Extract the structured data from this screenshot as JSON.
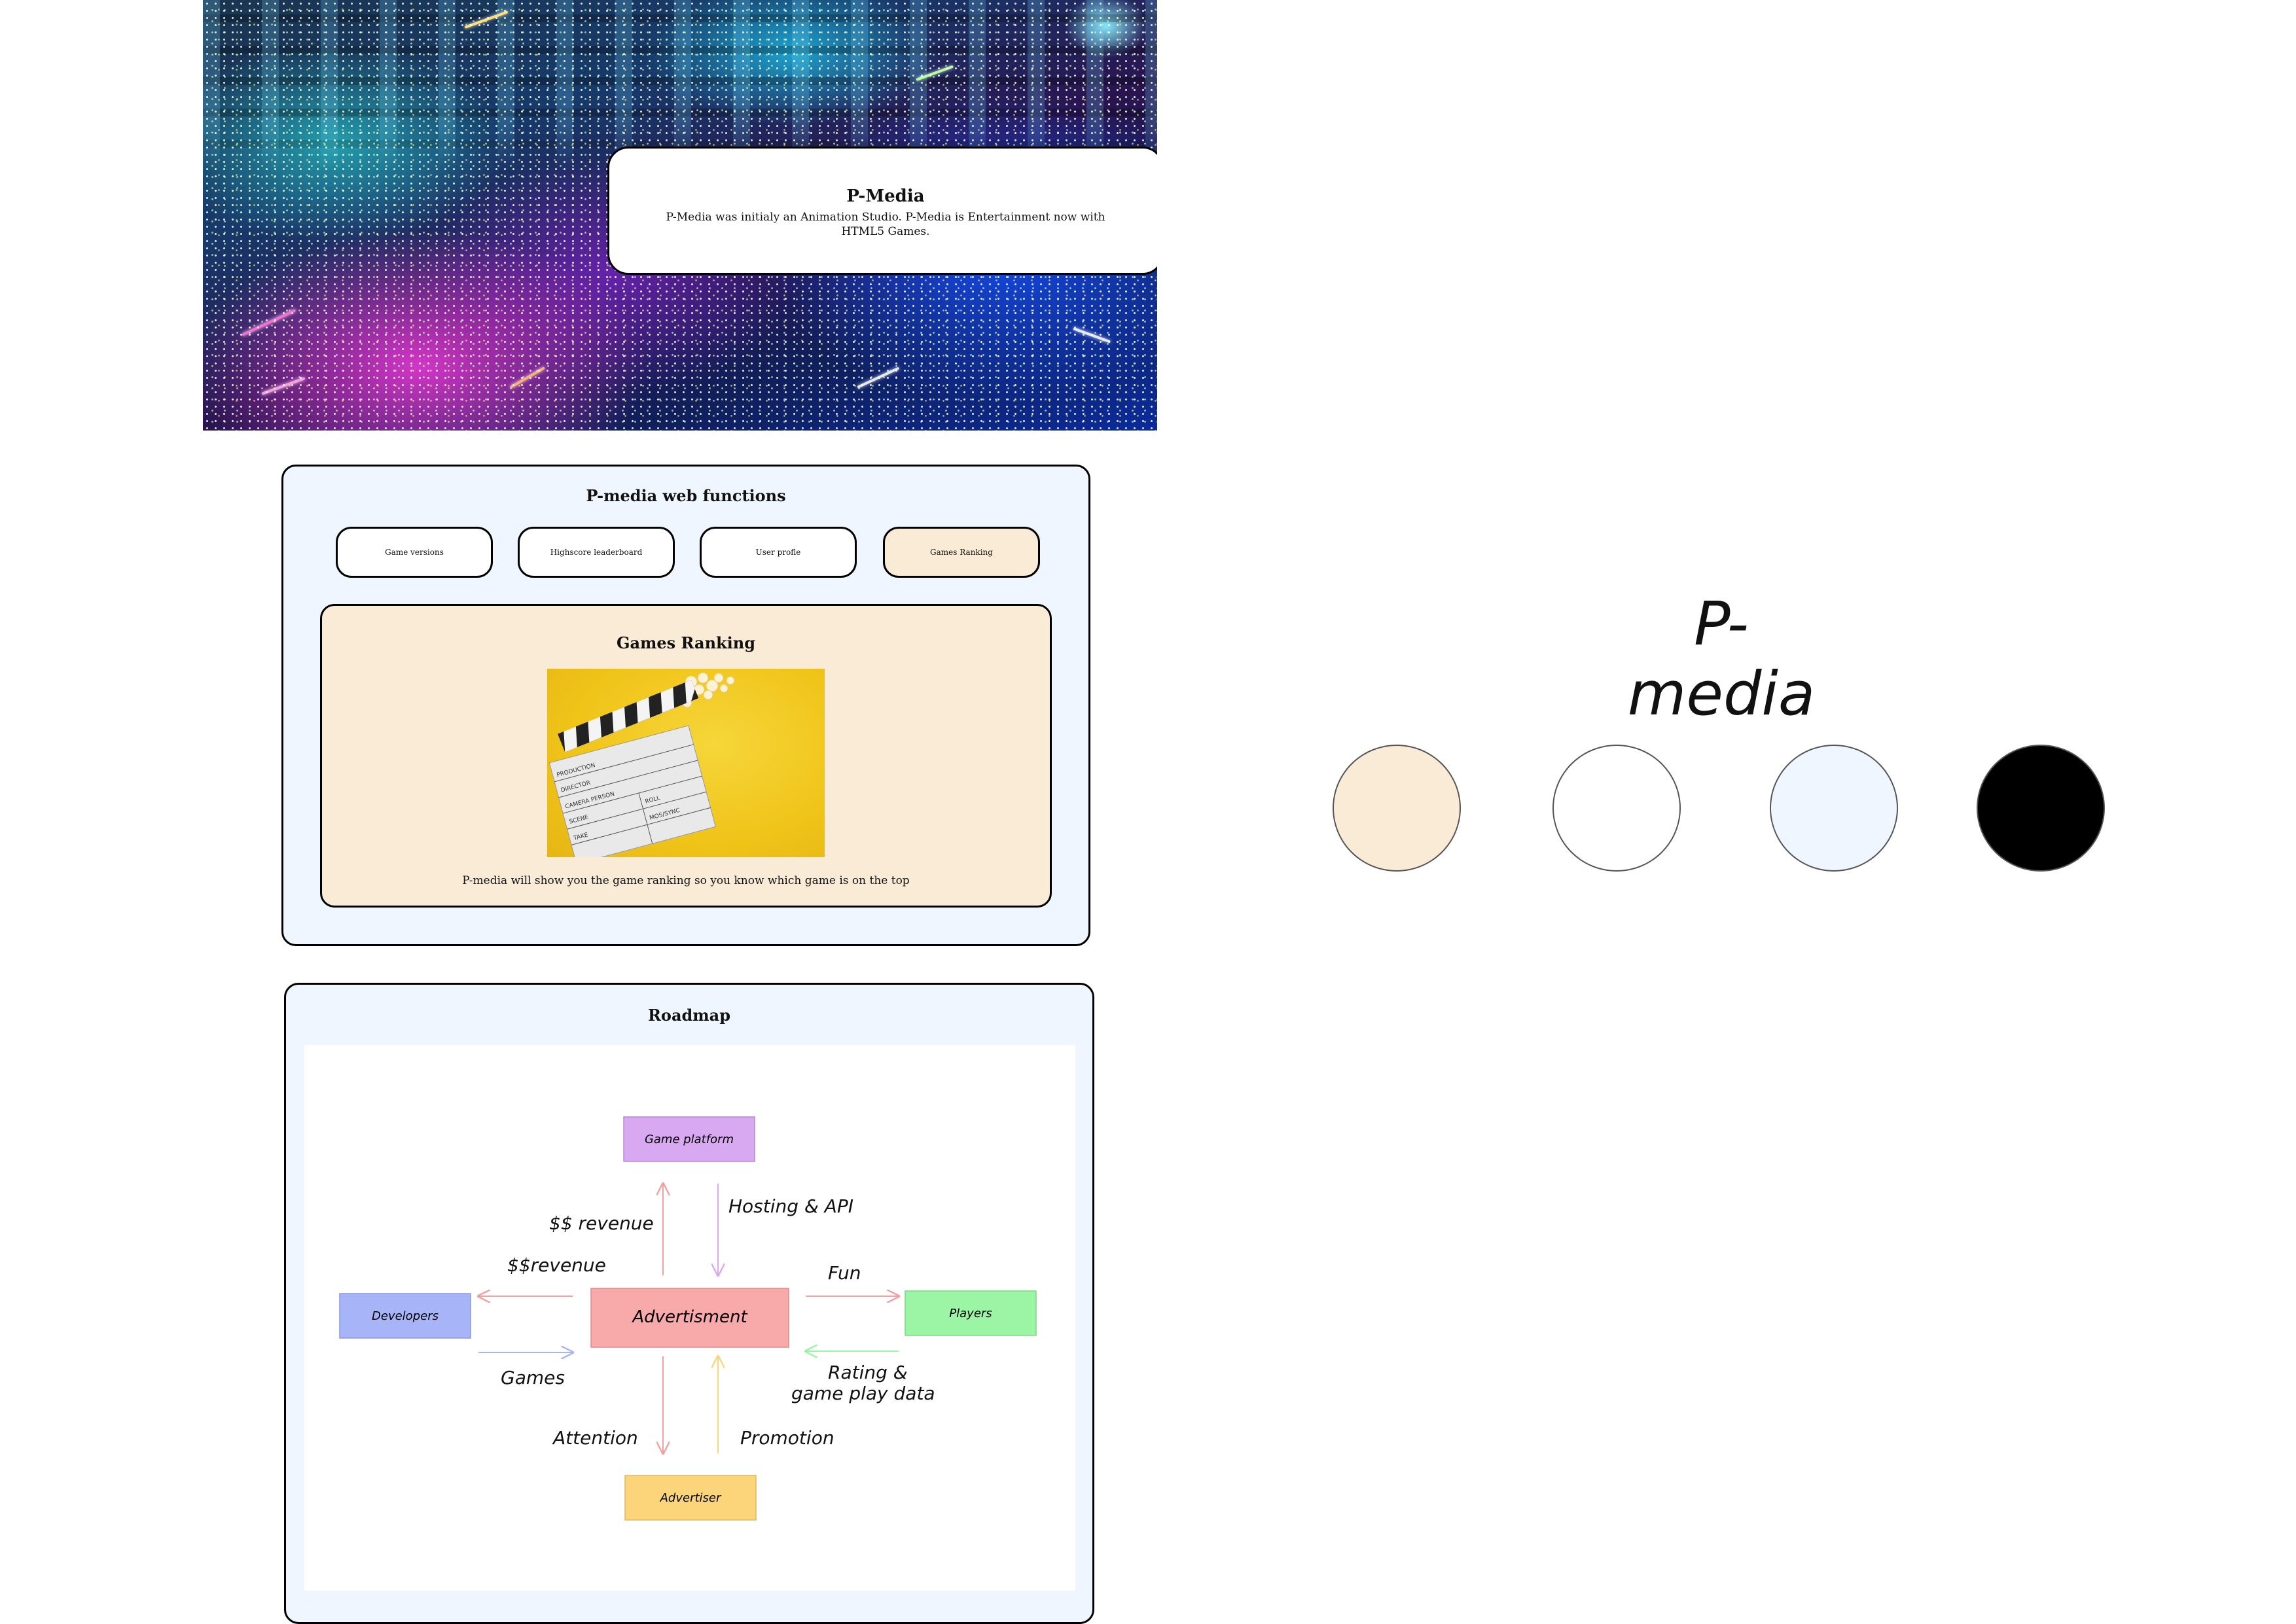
{
  "hero": {
    "title": "P-Media",
    "description": "P-Media was initialy an Animation Studio. P-Media is Entertainment now with HTML5 Games."
  },
  "functions": {
    "title": "P-media web functions",
    "buttons": [
      {
        "label": "Game versions",
        "active": false
      },
      {
        "label": "Highscore leaderboard",
        "active": false
      },
      {
        "label": "User profle",
        "active": false
      },
      {
        "label": "Games Ranking",
        "active": true
      }
    ],
    "ranking": {
      "title": "Games Ranking",
      "clapper_lines": [
        "PRODUCTION",
        "DIRECTOR",
        "CAMERA PERSON",
        "SCENE",
        "TAKE",
        "ROLL",
        "MOS/SYNC"
      ],
      "description": "P-media will show you the game ranking so you know which game is on the top"
    }
  },
  "roadmap": {
    "title": "Roadmap",
    "nodes": {
      "platform": "Game platform",
      "developers": "Developers",
      "advertisment": "Advertisment",
      "players": "Players",
      "advertiser": "Advertiser"
    },
    "labels": {
      "revenue_up": "$$ revenue",
      "hosting": "Hosting & API",
      "revenue_left": "$$revenue",
      "fun": "Fun",
      "games": "Games",
      "rating_1": "Rating &",
      "rating_2": "game play data",
      "attention": "Attention",
      "promotion": "Promotion"
    },
    "colors": {
      "platform": "#d8a8f0",
      "developers": "#a8b4f8",
      "advertisment": "#f8aaaa",
      "players": "#9cf5a4",
      "advertiser": "#fcd57a"
    }
  },
  "brand": {
    "name": "P-media",
    "palette": [
      "#faebd7",
      "#ffffff",
      "#eff6ff",
      "#000000"
    ]
  }
}
